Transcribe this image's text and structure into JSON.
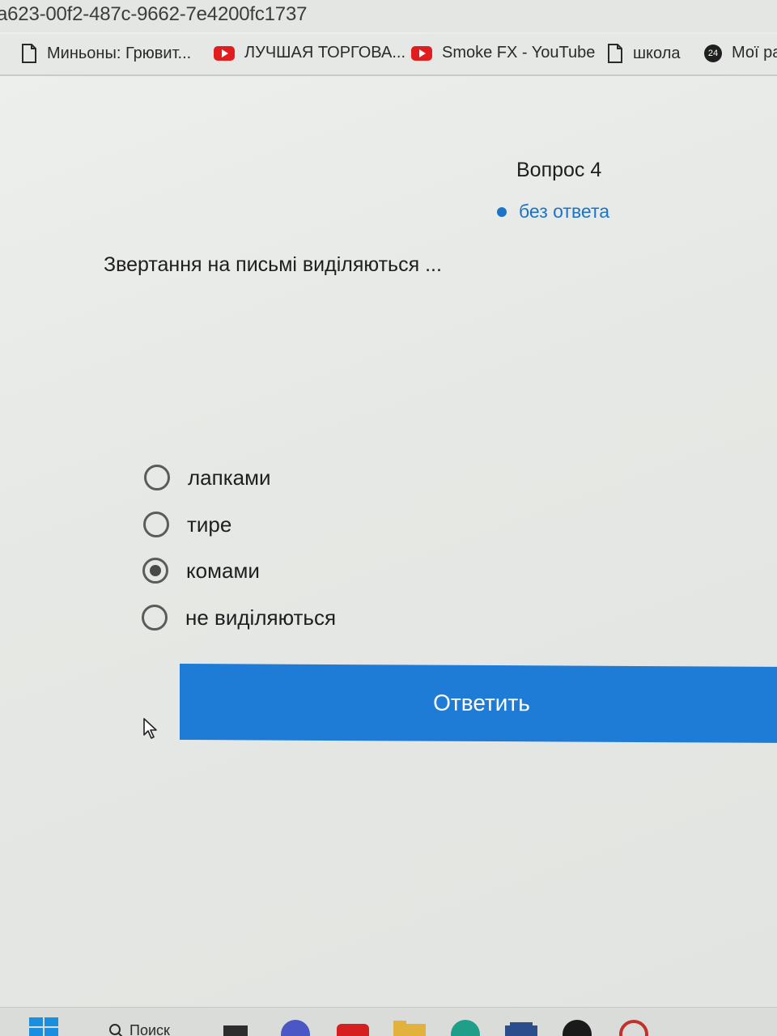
{
  "browser": {
    "url_fragment": "a623-00f2-487c-9662-7e4200fc1737",
    "bookmarks": [
      {
        "label": "Миньоны: Грювит...",
        "icon": "page-icon"
      },
      {
        "label": "ЛУЧШАЯ ТОРГОВА...",
        "icon": "youtube-icon"
      },
      {
        "label": "Smoke FX - YouTube",
        "icon": "youtube-icon"
      },
      {
        "label": "школа",
        "icon": "page-icon"
      },
      {
        "label": "Мої ра",
        "icon": "badge-24-icon",
        "badge": "24"
      }
    ]
  },
  "question": {
    "number_label": "Вопрос 4",
    "status_label": "без ответа",
    "text": "Звертання на письмі виділяються ...",
    "options": [
      {
        "label": "лапками",
        "selected": false
      },
      {
        "label": "тире",
        "selected": false
      },
      {
        "label": "комами",
        "selected": true
      },
      {
        "label": "не виділяються",
        "selected": false
      }
    ],
    "submit_label": "Ответить"
  },
  "taskbar": {
    "search_label": "Поиск"
  },
  "colors": {
    "accent": "#1e7bd6",
    "status": "#1b74c9"
  }
}
